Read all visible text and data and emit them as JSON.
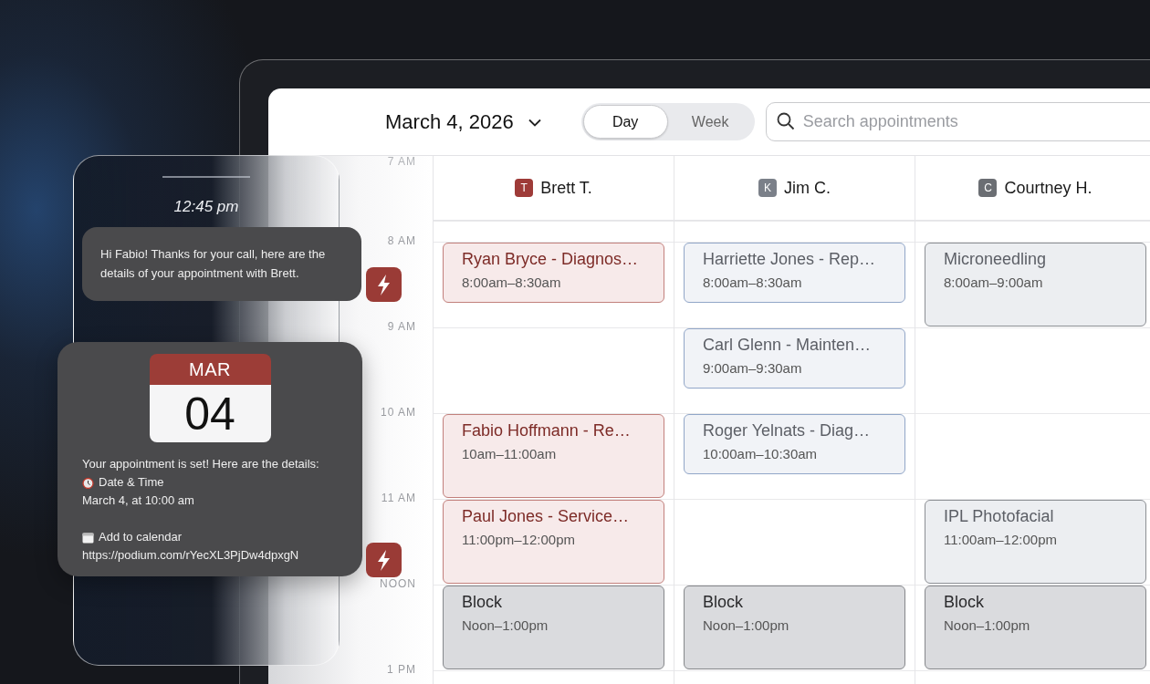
{
  "header": {
    "date": "March 4, 2026",
    "view_tabs": [
      {
        "label": "Day",
        "selected": true
      },
      {
        "label": "Week",
        "selected": false
      }
    ],
    "search": {
      "placeholder": "Search appointments"
    }
  },
  "time_labels": [
    "7 AM",
    "8 AM",
    "9 AM",
    "10 AM",
    "11 AM",
    "NOON",
    "1 PM"
  ],
  "staff": [
    {
      "initial": "T",
      "name": "Brett T.",
      "color": "#9e3b38",
      "appointments": [
        {
          "kind": "appointment",
          "title": "Ryan Bryce - Diagnos…",
          "time": "8:00am–8:30am"
        },
        {
          "kind": "appointment",
          "title": "Fabio Hoffmann - Re…",
          "time": "10am–11:00am"
        },
        {
          "kind": "appointment",
          "title": "Paul Jones - Service…",
          "time": "11:00pm–12:00pm"
        },
        {
          "kind": "block",
          "title": "Block",
          "time": "Noon–1:00pm"
        }
      ]
    },
    {
      "initial": "K",
      "name": "Jim C.",
      "color": "#7b8089",
      "appointments": [
        {
          "kind": "appointment",
          "title": "Harriette Jones - Rep…",
          "time": "8:00am–8:30am"
        },
        {
          "kind": "appointment",
          "title": "Carl Glenn - Mainten…",
          "time": "9:00am–9:30am"
        },
        {
          "kind": "appointment",
          "title": "Roger Yelnats - Diag…",
          "time": "10:00am–10:30am"
        },
        {
          "kind": "block",
          "title": "Block",
          "time": "Noon–1:00pm"
        }
      ]
    },
    {
      "initial": "C",
      "name": "Courtney H.",
      "color": "#6b6e73",
      "appointments": [
        {
          "kind": "appointment",
          "title": "Microneedling",
          "time": "8:00am–9:00am"
        },
        {
          "kind": "appointment",
          "title": "IPL Photofacial",
          "time": "11:00am–12:00pm"
        },
        {
          "kind": "block",
          "title": "Block",
          "time": "Noon–1:00pm"
        }
      ]
    }
  ],
  "messages": {
    "time": "12:45 pm",
    "greeting": "Hi Fabio! Thanks for your call, here are the details of your appointment with Brett.",
    "confirmation": {
      "month": "MAR",
      "day": "04",
      "lines": [
        {
          "kind": "text",
          "text": "Your appointment is set! Here are the details:"
        },
        {
          "kind": "alarm",
          "text": "Date & Time"
        },
        {
          "kind": "text",
          "text": "March 4, at 10:00 am"
        },
        {
          "kind": "calendar",
          "text": "Add to calendar"
        },
        {
          "kind": "link",
          "text": "https://podium.com/rYecXL3PjDw4dpxgN"
        }
      ]
    }
  }
}
